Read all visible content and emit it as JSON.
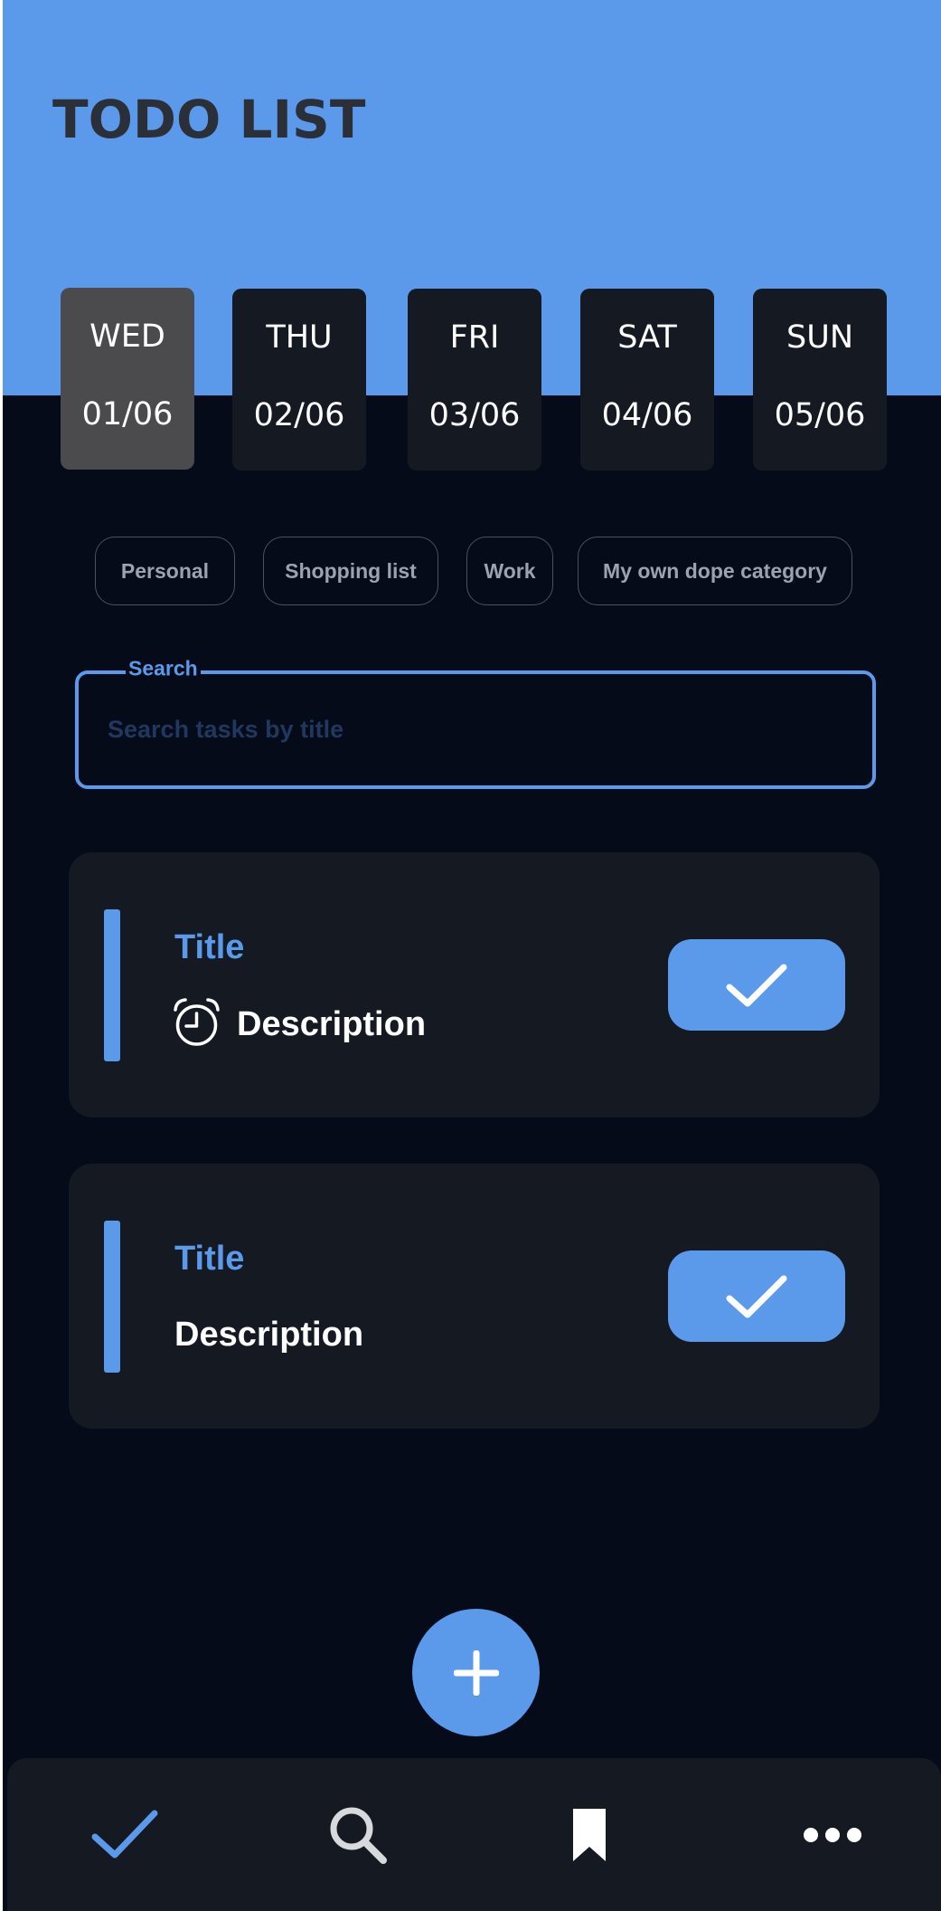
{
  "app": {
    "title": "TODO LIST"
  },
  "days": [
    {
      "name": "WED",
      "date": "01/06",
      "selected": true
    },
    {
      "name": "THU",
      "date": "02/06",
      "selected": false
    },
    {
      "name": "FRI",
      "date": "03/06",
      "selected": false
    },
    {
      "name": "SAT",
      "date": "04/06",
      "selected": false
    },
    {
      "name": "SUN",
      "date": "05/06",
      "selected": false
    }
  ],
  "categories": [
    "Personal",
    "Shopping list",
    "Work",
    "My own dope category"
  ],
  "search": {
    "label": "Search",
    "placeholder": "Search tasks by title",
    "value": ""
  },
  "tasks": [
    {
      "title": "Title",
      "description": "Description",
      "has_alarm": true
    },
    {
      "title": "Title",
      "description": "Description",
      "has_alarm": false
    }
  ],
  "icons": {
    "alarm": "alarm-clock-icon",
    "done": "checkmark-icon",
    "add": "plus-icon",
    "nav_tasks": "checkmark-icon",
    "nav_search": "search-icon",
    "nav_bookmarks": "bookmark-icon",
    "nav_more": "more-horizontal-icon"
  },
  "colors": {
    "accent": "#5b9aeb",
    "background": "#050b18",
    "surface": "#151a22",
    "selected_day": "#4b4b4d",
    "title_text": "#2b2f38"
  }
}
